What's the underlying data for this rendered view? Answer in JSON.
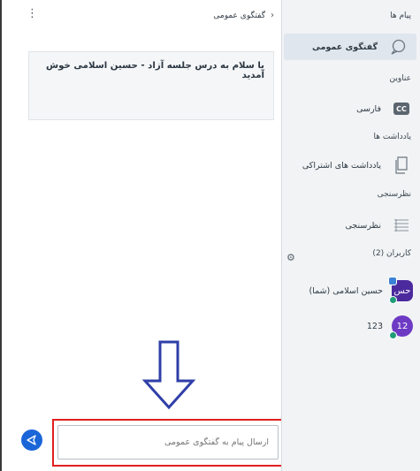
{
  "sidebar": {
    "messages_title": "پیام ها",
    "public_chat_label": "گفتگوی عمومی",
    "captions_title": "عناوین",
    "captions": {
      "badge": "CC",
      "language_label": "فارسی"
    },
    "notes_title": "یادداشت ها",
    "shared_notes_label": "یادداشت های اشتراکی",
    "polls_title": "نظرسنجی",
    "polling_label": "نظرسنجی",
    "users_title": "کاربران (2)",
    "users": [
      {
        "avatar_text": "حس",
        "name": "حسین اسلامی (شما)"
      },
      {
        "avatar_text": "12",
        "name": "123"
      }
    ]
  },
  "chat": {
    "title": "گفتگوی عمومی",
    "welcome_message": "با سلام به درس جلسه آزاد - حسین اسلامی خوش آمدید",
    "input_placeholder": "ارسال پیام به گفتگوی عمومی"
  },
  "colors": {
    "accent": "#1a66d8",
    "highlight_border": "#e02020",
    "arrow": "#2f3fa8",
    "sidebar_bg": "#f1f3f5"
  },
  "icons": {
    "back": "chevron-right-icon",
    "menu": "kebab-menu-icon",
    "chat": "chat-bubble-icon",
    "notes": "document-icon",
    "poll": "list-icon",
    "settings": "gear-icon",
    "send": "send-icon",
    "annotation": "down-arrow-icon"
  }
}
